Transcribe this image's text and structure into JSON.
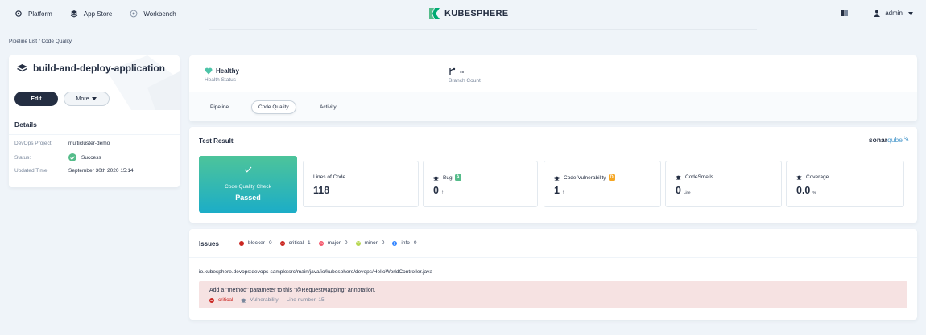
{
  "nav": {
    "items": [
      {
        "label": "Platform",
        "icon": "gear-icon"
      },
      {
        "label": "App Store",
        "icon": "app-store-icon"
      },
      {
        "label": "Workbench",
        "icon": "workbench-icon"
      }
    ],
    "logo": "KUBESPHERE",
    "user": "admin"
  },
  "breadcrumb": "Pipeline List / Code Quality",
  "pipeline": {
    "name": "build-and-deploy-application",
    "description": "-",
    "edit_label": "Edit",
    "more_label": "More"
  },
  "details": {
    "title": "Details",
    "rows": [
      {
        "key": "DevOps Project:",
        "value": "multicluster-demo"
      },
      {
        "key": "Status:",
        "value": "Success"
      },
      {
        "key": "Updated Time:",
        "value": "September 30th 2020 15:14"
      }
    ]
  },
  "summary": {
    "health_value": "Healthy",
    "health_label": "Health Status",
    "branch_value": "--",
    "branch_label": "Branch Count"
  },
  "tabs": [
    {
      "label": "Pipeline",
      "active": false
    },
    {
      "label": "Code Quality",
      "active": true
    },
    {
      "label": "Activity",
      "active": false
    }
  ],
  "test_result": {
    "title": "Test Result",
    "sonar_bold": "sonar",
    "sonar_light": "qube",
    "quality_check_label": "Code Quality Check",
    "quality_check_result": "Passed",
    "metrics": [
      {
        "label": "Lines of Code",
        "value": "118",
        "unit": "",
        "grade": "",
        "grade_color": ""
      },
      {
        "label": "Bug",
        "value": "0",
        "unit": "↑",
        "grade": "A",
        "grade_color": "#55bc8a"
      },
      {
        "label": "Code Vulnerability",
        "value": "1",
        "unit": "↑",
        "grade": "D",
        "grade_color": "#f5a623"
      },
      {
        "label": "CodeSmells",
        "value": "0",
        "unit": "Line",
        "grade": "",
        "grade_color": ""
      },
      {
        "label": "Coverage",
        "value": "0.0",
        "unit": "%",
        "grade": "",
        "grade_color": ""
      }
    ]
  },
  "issues": {
    "title": "Issues",
    "legend": [
      {
        "label": "blocker",
        "count": "0",
        "color": "#ca2621"
      },
      {
        "label": "critical",
        "count": "1",
        "color": "#ca2621"
      },
      {
        "label": "major",
        "count": "0",
        "color": "#f5576c"
      },
      {
        "label": "minor",
        "count": "0",
        "color": "#b5d64d"
      },
      {
        "label": "info",
        "count": "0",
        "color": "#3385ff"
      }
    ],
    "file": "io.kubesphere.devops:devops-sample:src/main/java/io/kubesphere/devops/HelloWorldController.java",
    "item": {
      "message": "Add a \"method\" parameter to this \"@RequestMapping\" annotation.",
      "severity": "critical",
      "type": "Vulnerability",
      "line": "Line number: 15"
    }
  },
  "colors": {
    "success": "#55bc8a",
    "dark": "#242e42",
    "issue_bg": "#f6e2e2"
  }
}
